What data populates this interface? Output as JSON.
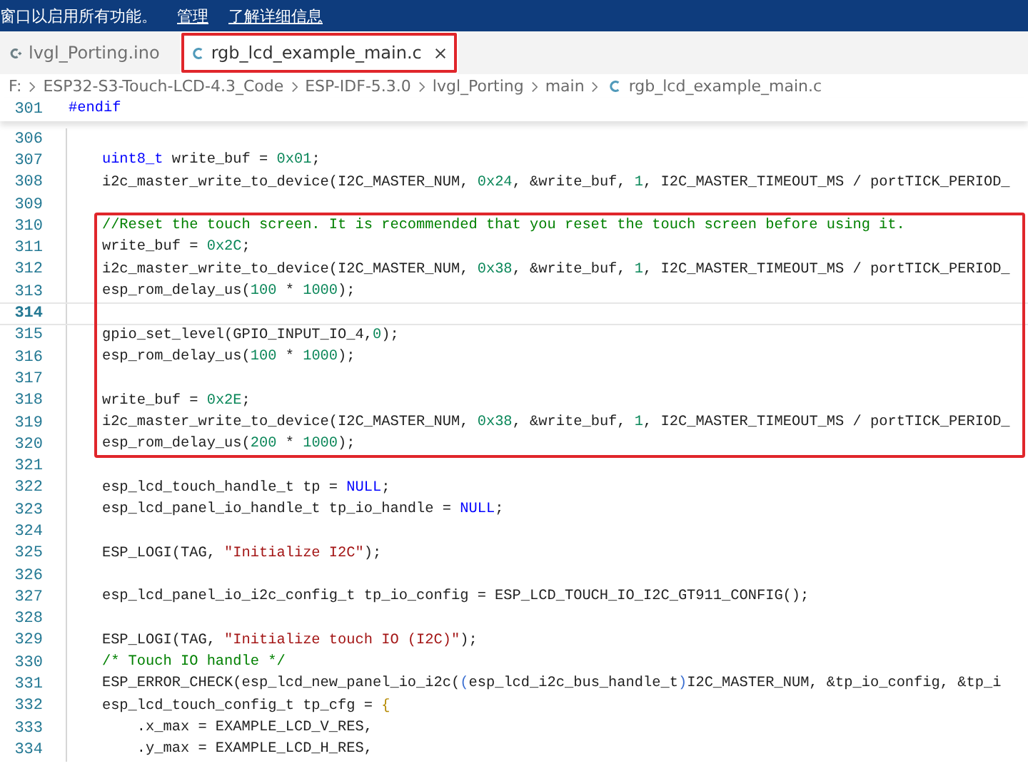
{
  "notice_bar": {
    "message": "窗口以启用所有功能。",
    "links": [
      "管理",
      "了解详细信息"
    ]
  },
  "tabs": [
    {
      "label": "lvgl_Porting.ino",
      "kind": "sketch",
      "selected": false,
      "annotated": false
    },
    {
      "label": "rgb_lcd_example_main.c",
      "kind": "source",
      "selected": true,
      "annotated": true
    }
  ],
  "breadcrumb": [
    "F:",
    "ESP32-S3-Touch-LCD-4.3_Code",
    "ESP-IDF-5.3.0",
    "lvgl_Porting",
    "main",
    "rgb_lcd_example_main.c"
  ],
  "sticky_line": {
    "number": "301",
    "tokens": [
      {
        "kind": "macro",
        "text": "#endif"
      }
    ]
  },
  "code": [
    {
      "highlighted": false,
      "lines": [
        {
          "number": "306",
          "current": false
        },
        {
          "number": "307",
          "current": false,
          "tokens": [
            {
              "kind": "type",
              "text": "    uint8_t"
            },
            {
              "kind": "plain",
              "text": " write_buf = "
            },
            {
              "kind": "num",
              "text": "0x01"
            },
            {
              "kind": "plain",
              "text": ";"
            }
          ]
        },
        {
          "number": "308",
          "current": false,
          "tokens": [
            {
              "kind": "plain",
              "text": "    i2c_master_write_to_device(I2C_MASTER_NUM, "
            },
            {
              "kind": "num",
              "text": "0x24"
            },
            {
              "kind": "plain",
              "text": ", &write_buf, "
            },
            {
              "kind": "num",
              "text": "1"
            },
            {
              "kind": "plain",
              "text": ", I2C_MASTER_TIMEOUT_MS / portTICK_PERIOD_"
            }
          ]
        },
        {
          "number": "309",
          "current": false
        }
      ]
    },
    {
      "highlighted": true,
      "lines": [
        {
          "number": "310",
          "current": false,
          "tokens": [
            {
              "kind": "comment",
              "text": "    //Reset the touch screen. It is recommended that you reset the touch screen before using it."
            }
          ]
        },
        {
          "number": "311",
          "current": false,
          "tokens": [
            {
              "kind": "plain",
              "text": "    write_buf = "
            },
            {
              "kind": "num",
              "text": "0x2C"
            },
            {
              "kind": "plain",
              "text": ";"
            }
          ]
        },
        {
          "number": "312",
          "current": false,
          "tokens": [
            {
              "kind": "plain",
              "text": "    i2c_master_write_to_device(I2C_MASTER_NUM, "
            },
            {
              "kind": "num",
              "text": "0x38"
            },
            {
              "kind": "plain",
              "text": ", &write_buf, "
            },
            {
              "kind": "num",
              "text": "1"
            },
            {
              "kind": "plain",
              "text": ", I2C_MASTER_TIMEOUT_MS / portTICK_PERIOD_"
            }
          ]
        },
        {
          "number": "313",
          "current": false,
          "tokens": [
            {
              "kind": "plain",
              "text": "    esp_rom_delay_us("
            },
            {
              "kind": "num",
              "text": "100"
            },
            {
              "kind": "plain",
              "text": " * "
            },
            {
              "kind": "num",
              "text": "1000"
            },
            {
              "kind": "plain",
              "text": ");"
            }
          ]
        },
        {
          "number": "314",
          "current": true
        },
        {
          "number": "315",
          "current": false,
          "tokens": [
            {
              "kind": "plain",
              "text": "    gpio_set_level(GPIO_INPUT_IO_4,"
            },
            {
              "kind": "num",
              "text": "0"
            },
            {
              "kind": "plain",
              "text": ");"
            }
          ]
        },
        {
          "number": "316",
          "current": false,
          "tokens": [
            {
              "kind": "plain",
              "text": "    esp_rom_delay_us("
            },
            {
              "kind": "num",
              "text": "100"
            },
            {
              "kind": "plain",
              "text": " * "
            },
            {
              "kind": "num",
              "text": "1000"
            },
            {
              "kind": "plain",
              "text": ");"
            }
          ]
        },
        {
          "number": "317",
          "current": false
        },
        {
          "number": "318",
          "current": false,
          "tokens": [
            {
              "kind": "plain",
              "text": "    write_buf = "
            },
            {
              "kind": "num",
              "text": "0x2E"
            },
            {
              "kind": "plain",
              "text": ";"
            }
          ]
        },
        {
          "number": "319",
          "current": false,
          "tokens": [
            {
              "kind": "plain",
              "text": "    i2c_master_write_to_device(I2C_MASTER_NUM, "
            },
            {
              "kind": "num",
              "text": "0x38"
            },
            {
              "kind": "plain",
              "text": ", &write_buf, "
            },
            {
              "kind": "num",
              "text": "1"
            },
            {
              "kind": "plain",
              "text": ", I2C_MASTER_TIMEOUT_MS / portTICK_PERIOD_"
            }
          ]
        },
        {
          "number": "320",
          "current": false,
          "tokens": [
            {
              "kind": "plain",
              "text": "    esp_rom_delay_us("
            },
            {
              "kind": "num",
              "text": "200"
            },
            {
              "kind": "plain",
              "text": " * "
            },
            {
              "kind": "num",
              "text": "1000"
            },
            {
              "kind": "plain",
              "text": ");"
            }
          ]
        }
      ]
    },
    {
      "highlighted": false,
      "lines": [
        {
          "number": "321",
          "current": false
        },
        {
          "number": "322",
          "current": false,
          "tokens": [
            {
              "kind": "plain",
              "text": "    esp_lcd_touch_handle_t tp = "
            },
            {
              "kind": "const",
              "text": "NULL"
            },
            {
              "kind": "plain",
              "text": ";"
            }
          ]
        },
        {
          "number": "323",
          "current": false,
          "tokens": [
            {
              "kind": "plain",
              "text": "    esp_lcd_panel_io_handle_t tp_io_handle = "
            },
            {
              "kind": "const",
              "text": "NULL"
            },
            {
              "kind": "plain",
              "text": ";"
            }
          ]
        },
        {
          "number": "324",
          "current": false
        },
        {
          "number": "325",
          "current": false,
          "tokens": [
            {
              "kind": "plain",
              "text": "    ESP_LOGI(TAG, "
            },
            {
              "kind": "str",
              "text": "\"Initialize I2C\""
            },
            {
              "kind": "plain",
              "text": ");"
            }
          ]
        },
        {
          "number": "326",
          "current": false
        },
        {
          "number": "327",
          "current": false,
          "tokens": [
            {
              "kind": "plain",
              "text": "    esp_lcd_panel_io_i2c_config_t tp_io_config = ESP_LCD_TOUCH_IO_I2C_GT911_CONFIG();"
            }
          ]
        },
        {
          "number": "328",
          "current": false
        },
        {
          "number": "329",
          "current": false,
          "tokens": [
            {
              "kind": "plain",
              "text": "    ESP_LOGI(TAG, "
            },
            {
              "kind": "str",
              "text": "\"Initialize touch IO (I2C)\""
            },
            {
              "kind": "plain",
              "text": ");"
            }
          ]
        },
        {
          "number": "330",
          "current": false,
          "tokens": [
            {
              "kind": "comment",
              "text": "    /* Touch IO handle */"
            }
          ]
        },
        {
          "number": "331",
          "current": false,
          "tokens": [
            {
              "kind": "plain",
              "text": "    ESP_ERROR_CHECK(esp_lcd_new_panel_io_i2c("
            },
            {
              "kind": "bracket",
              "text": "("
            },
            {
              "kind": "plain",
              "text": "esp_lcd_i2c_bus_handle_t"
            },
            {
              "kind": "bracket",
              "text": ")"
            },
            {
              "kind": "plain",
              "text": "I2C_MASTER_NUM, &tp_io_config, &tp_i"
            }
          ]
        },
        {
          "number": "332",
          "current": false,
          "tokens": [
            {
              "kind": "plain",
              "text": "    esp_lcd_touch_config_t tp_cfg = "
            },
            {
              "kind": "brace",
              "text": "{"
            }
          ]
        },
        {
          "number": "333",
          "current": false,
          "tokens": [
            {
              "kind": "plain",
              "text": "        .x_max = EXAMPLE_LCD_V_RES,"
            }
          ]
        },
        {
          "number": "334",
          "current": false,
          "tokens": [
            {
              "kind": "plain",
              "text": "        .y_max = EXAMPLE_LCD_H_RES,"
            }
          ]
        }
      ]
    }
  ]
}
